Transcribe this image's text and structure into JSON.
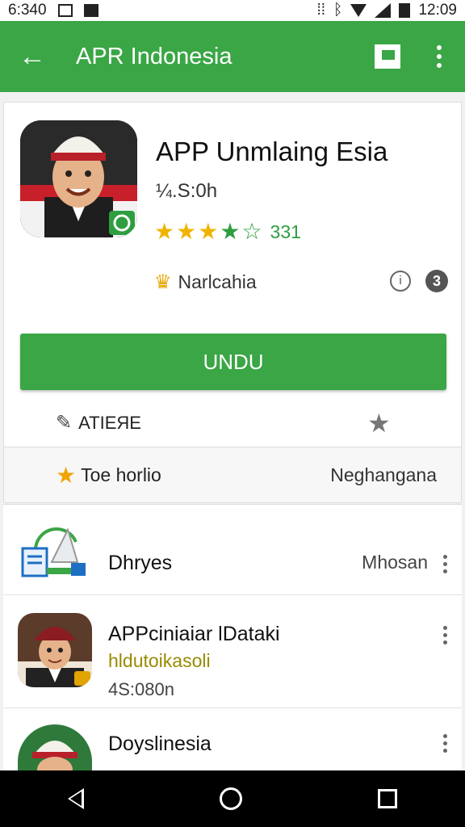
{
  "status_bar": {
    "time_left": "6:340",
    "time_right": "12:09"
  },
  "app_bar": {
    "back_glyph": "←",
    "title": "APR Indonesia",
    "flag_icon": "flag-icon",
    "menu_icon": "more-vert-icon"
  },
  "app": {
    "name": "APP Unmlaing Esia",
    "size": "¼.S:0h",
    "rating_count": "331",
    "developer": "Narlcahia",
    "info_icon": "i",
    "badge": "3",
    "install_label": "UNDU",
    "share_label": "ATIEЯE",
    "row_label": "Toe horlio",
    "row_value": "Neghangana"
  },
  "list": [
    {
      "title": "Dhryes",
      "right": "Mhosan"
    },
    {
      "title": "APPciniaiar lDataki",
      "subtitle": "hldutoikasoli",
      "meta": "4S:080n"
    },
    {
      "title": "Doyslinesia"
    }
  ],
  "colors": {
    "accent": "#3aa645",
    "star": "#f0b400",
    "star_green": "#2e9e40"
  }
}
